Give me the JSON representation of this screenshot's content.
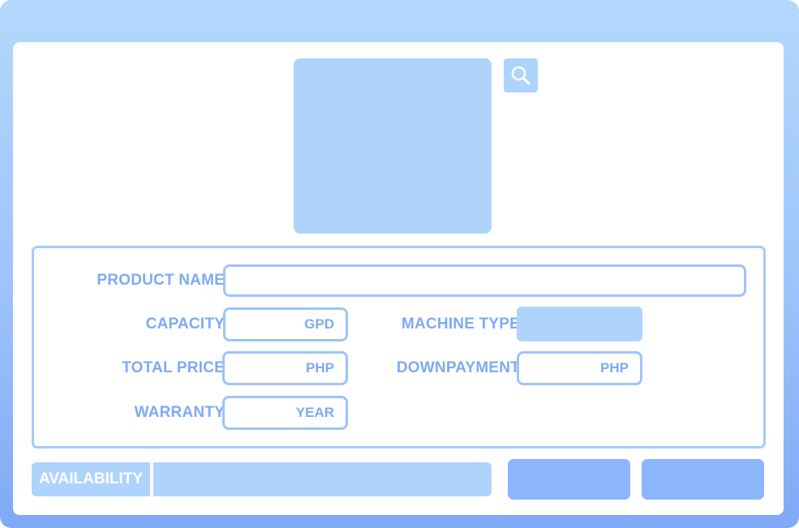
{
  "form": {
    "product_name_label": "PRODUCT NAME",
    "capacity_label": "CAPACITY",
    "capacity_unit": "GPD",
    "machine_type_label": "MACHINE TYPE",
    "total_price_label": "TOTAL PRICE",
    "total_price_unit": "PHP",
    "downpayment_label": "DOWNPAYMENT",
    "downpayment_unit": "PHP",
    "warranty_label": "WARRANTY",
    "warranty_unit": "YEAR"
  },
  "availability": {
    "label": "AVAILABILITY"
  },
  "icons": {
    "search": "search-icon"
  },
  "colors": {
    "accent": "#aed4fd",
    "label_text": "#7eaaf4",
    "button": "#8cb6fb",
    "frame_top": "#b4d8fc",
    "frame_bottom": "#7fa9f5"
  }
}
